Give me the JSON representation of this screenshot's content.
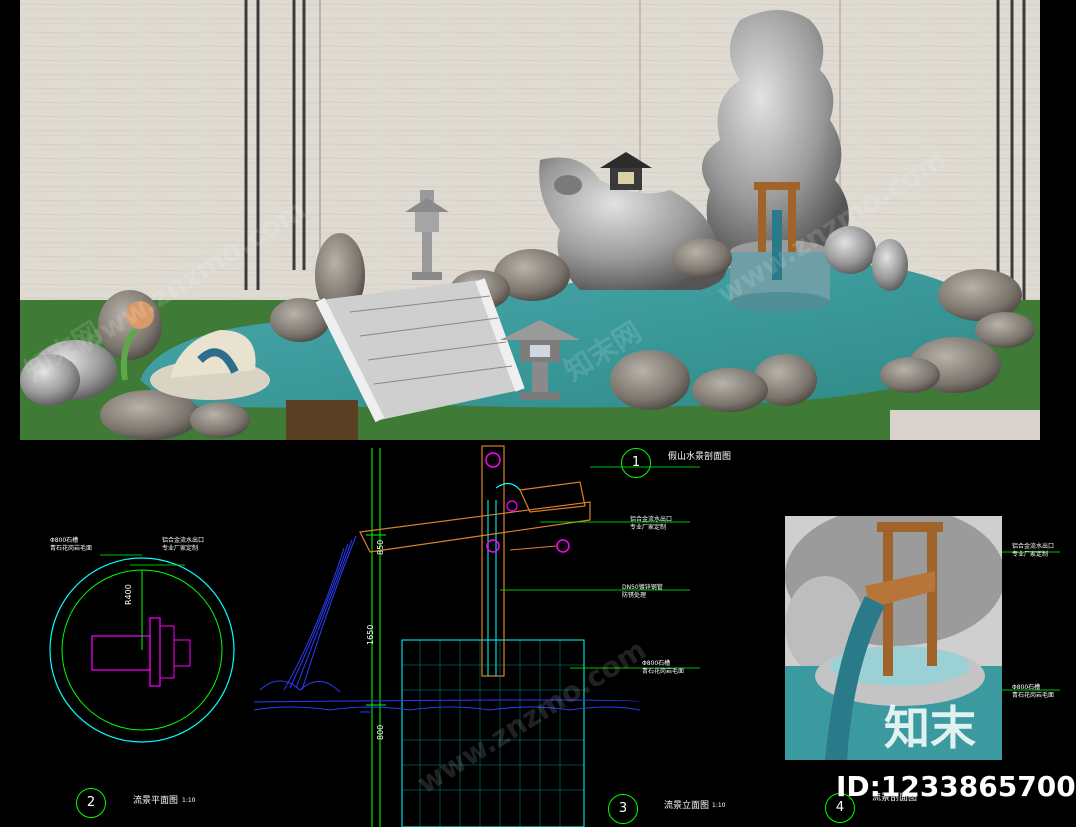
{
  "drawings": {
    "view1": {
      "number": "1",
      "title": "假山水景剖面图"
    },
    "view2": {
      "number": "2",
      "title": "流景平面图",
      "scale": "1:10"
    },
    "view3": {
      "number": "3",
      "title": "流景立面图",
      "scale": "1:10"
    },
    "view4": {
      "number": "4",
      "title": "流景剖面图"
    }
  },
  "annotations": {
    "plan_a": "Φ800石槽\n青石花岗岩毛面",
    "plan_b": "铝合金流水出口\n专业厂家定制",
    "plan_radius": "R400",
    "elev_a": "铝合金流水出口\n专业厂家定制",
    "elev_b": "DN50镀锌钢管\n防锈处理",
    "elev_c": "Φ800石槽\n青石花岗岩毛面",
    "photo_a": "铝合金流水出口\n专业厂家定制",
    "photo_b": "Φ800石槽\n青石花岗岩毛面"
  },
  "dimensions": {
    "top": "850",
    "middle": "1650",
    "bottom": "800"
  },
  "watermarks": [
    "www.znzmo.com",
    "知末网"
  ],
  "brand": "知末",
  "image_id": "ID:1233865700",
  "colors": {
    "grass": "#3f7a36",
    "water": "#3a9aa0",
    "wall": "#dcd8cf",
    "cad_green": "#00ff00",
    "cad_magenta": "#ff00ff",
    "cad_cyan": "#00ffff",
    "cad_blue": "#0000ff",
    "wood": "#a0642a"
  }
}
